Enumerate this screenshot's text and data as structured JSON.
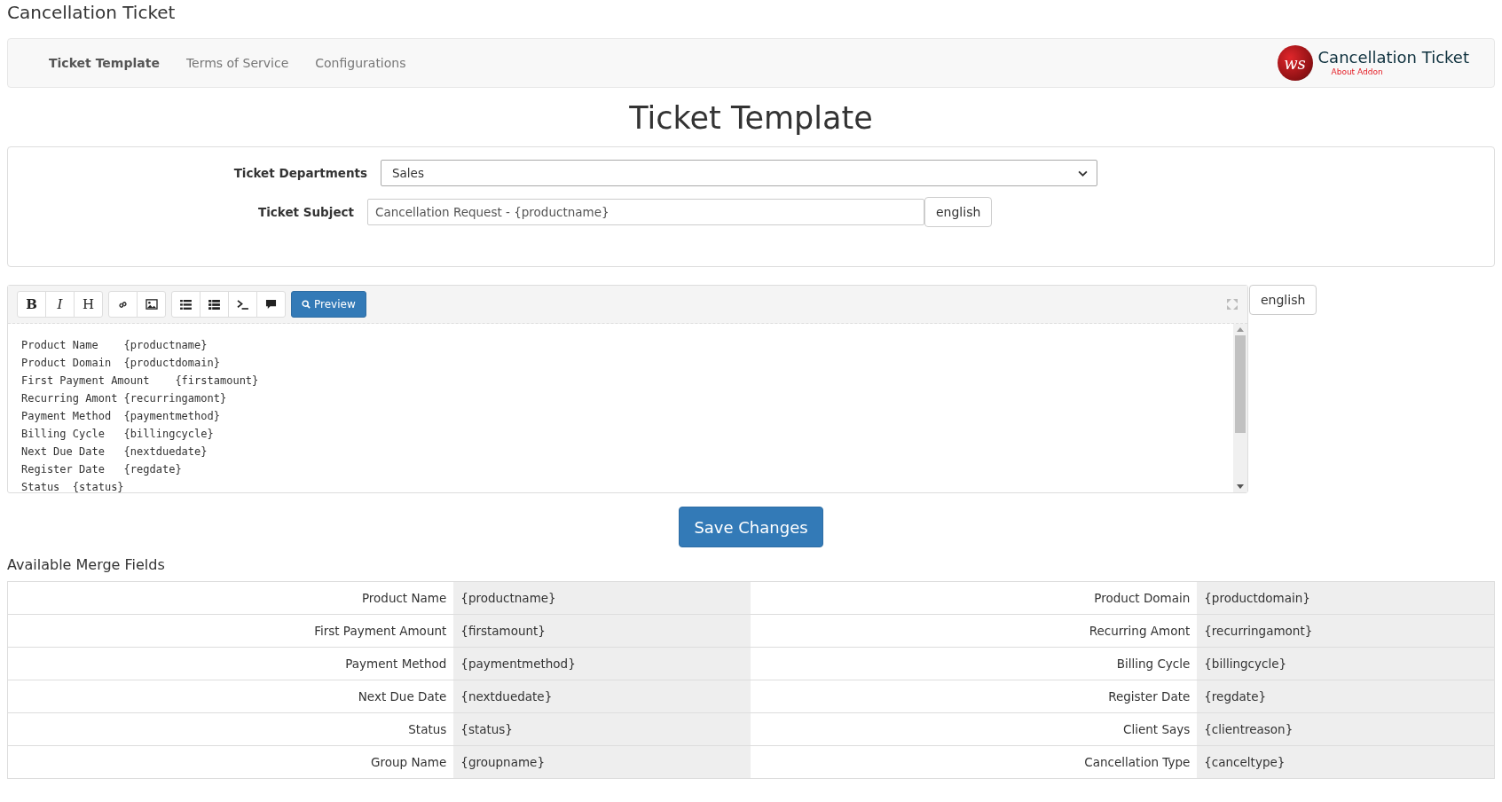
{
  "page_title": "Cancellation Ticket",
  "nav": {
    "tabs": [
      {
        "label": "Ticket Template",
        "selected": true
      },
      {
        "label": "Terms of Service",
        "selected": false
      },
      {
        "label": "Configurations",
        "selected": false
      }
    ],
    "logo": {
      "mark": "ws",
      "title": "Cancellation Ticket",
      "link": "About Addon"
    }
  },
  "heading": "Ticket Template",
  "form": {
    "department": {
      "label": "Ticket Departments",
      "value": "Sales"
    },
    "subject": {
      "label": "Ticket Subject",
      "value": "Cancellation Request - {productname}",
      "language": "english"
    }
  },
  "editor": {
    "toolbar": [
      [
        {
          "kind": "bold",
          "label": "B"
        },
        {
          "kind": "italic",
          "label": "I"
        },
        {
          "kind": "heading",
          "label": "H"
        }
      ],
      [
        {
          "kind": "link"
        },
        {
          "kind": "image"
        }
      ],
      [
        {
          "kind": "unordered-list"
        },
        {
          "kind": "ordered-list"
        },
        {
          "kind": "code"
        },
        {
          "kind": "comment"
        }
      ]
    ],
    "preview": "Preview",
    "language": "english",
    "lines": [
      "Product Name    {productname}",
      "Product Domain  {productdomain}",
      "First Payment Amount    {firstamount}",
      "Recurring Amont {recurringamont}",
      "Payment Method  {paymentmethod}",
      "Billing Cycle   {billingcycle}",
      "Next Due Date   {nextduedate}",
      "Register Date   {regdate}",
      "Status  {status}"
    ]
  },
  "save": "Save Changes",
  "merge_fields": {
    "title": "Available Merge Fields",
    "rows": [
      [
        "Product Name",
        "{productname}",
        "Product Domain",
        "{productdomain}"
      ],
      [
        "First Payment Amount",
        "{firstamount}",
        "Recurring Amont",
        "{recurringamont}"
      ],
      [
        "Payment Method",
        "{paymentmethod}",
        "Billing Cycle",
        "{billingcycle}"
      ],
      [
        "Next Due Date",
        "{nextduedate}",
        "Register Date",
        "{regdate}"
      ],
      [
        "Status",
        "{status}",
        "Client Says",
        "{clientreason}"
      ],
      [
        "Group Name",
        "{groupname}",
        "Cancellation Type",
        "{canceltype}"
      ]
    ]
  }
}
